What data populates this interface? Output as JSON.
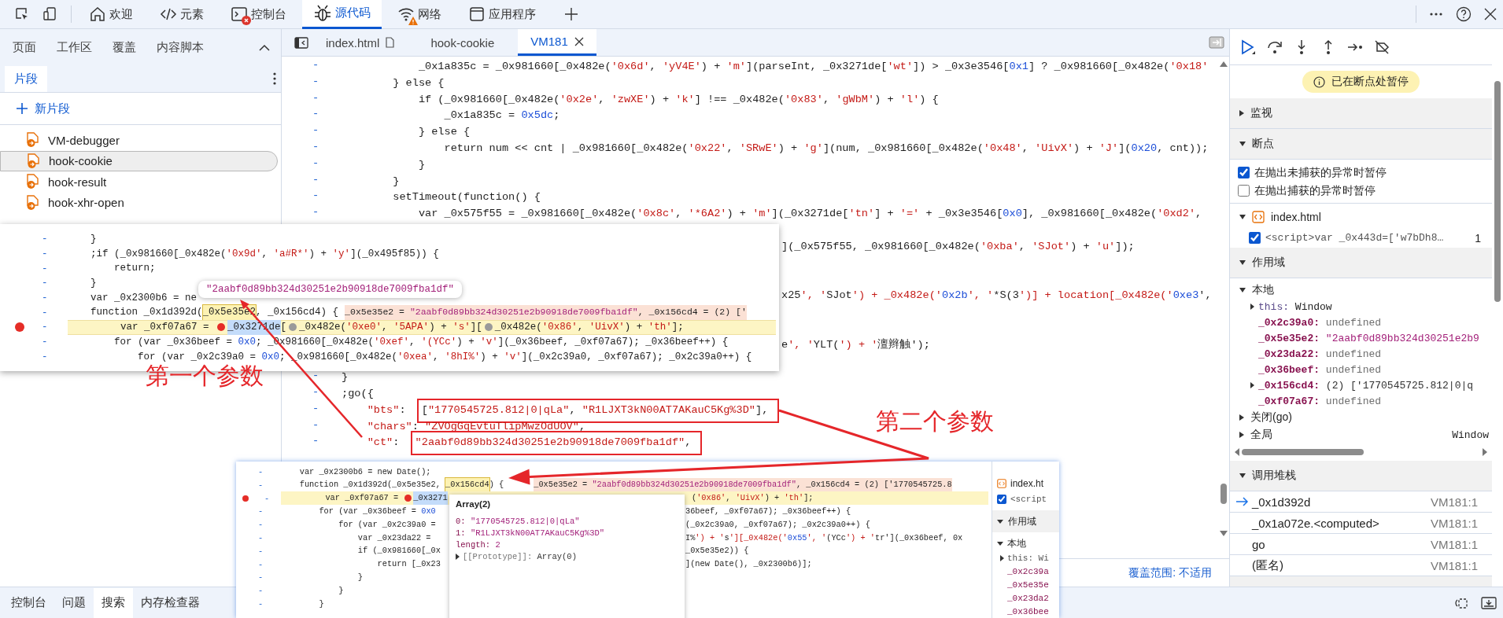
{
  "devtools_tabs": [
    {
      "label": "欢迎",
      "selected": false,
      "errors": false,
      "warnings": false
    },
    {
      "label": "元素",
      "selected": false,
      "errors": false,
      "warnings": false
    },
    {
      "label": "控制台",
      "selected": false,
      "errors": true,
      "warnings": false
    },
    {
      "label": "源代码",
      "selected": true,
      "errors": false,
      "warnings": false
    },
    {
      "label": "网络",
      "selected": false,
      "errors": false,
      "warnings": true
    },
    {
      "label": "应用程序",
      "selected": false,
      "errors": false,
      "warnings": false
    }
  ],
  "sidebar": {
    "tabs": [
      {
        "label": "页面",
        "selected": false
      },
      {
        "label": "工作区",
        "selected": false
      },
      {
        "label": "覆盖",
        "selected": false
      },
      {
        "label": "内容脚本",
        "selected": false
      }
    ],
    "subtabs": [
      {
        "label": "片段",
        "selected": true
      }
    ],
    "new_snippet": "新片段",
    "snippets": [
      {
        "name": "VM-debugger",
        "selected": false
      },
      {
        "name": "hook-cookie",
        "selected": true
      },
      {
        "name": "hook-result",
        "selected": false
      },
      {
        "name": "hook-xhr-open",
        "selected": false
      }
    ]
  },
  "editor": {
    "tabs": [
      {
        "label": "index.html",
        "selected": false,
        "kind": "file"
      },
      {
        "label": "hook-cookie",
        "selected": false,
        "kind": "snippet"
      },
      {
        "label": "VM181",
        "selected": true,
        "kind": "script"
      }
    ],
    "lines": [
      {
        "kind": "code",
        "gutter": "-",
        "text": "            _0x1a835c = _0x981660[_0x482e('0x6d', 'yV4E') + 'm'](parseInt, _0x3271de['wt']) > _0x3e3546[0x1] ? _0x981660[_0x482e('0x18'"
      },
      {
        "kind": "code",
        "gutter": "-",
        "text": "        } else {"
      },
      {
        "kind": "code",
        "gutter": "-",
        "text": "            if (_0x981660[_0x482e('0x2e', 'zwXE') + 'k'] !== _0x482e('0x83', 'gWbM') + 'l') {"
      },
      {
        "kind": "code",
        "gutter": "-",
        "text": "                _0x1a835c = 0x5dc;"
      },
      {
        "kind": "code",
        "gutter": "-",
        "text": "            } else {"
      },
      {
        "kind": "code",
        "gutter": "-",
        "text": "                return num << cnt | _0x981660[_0x482e('0x22', 'SRwE') + 'g'](num, _0x981660[_0x482e('0x48', 'UivX') + 'J'](0x20, cnt));"
      },
      {
        "kind": "code",
        "gutter": "-",
        "text": "            }"
      },
      {
        "kind": "code",
        "gutter": "-",
        "text": "        }"
      },
      {
        "kind": "code",
        "gutter": "-",
        "text": "        setTimeout(function() {"
      },
      {
        "kind": "code",
        "gutter": "-",
        "text": "            var _0x575f55 = _0x981660[_0x482e('0x8c', '*6A2') + 'm'](_0x3271de['tn'] + '=' + _0x3e3546[0x0], _0x981660[_0x482e('0xd2',"
      },
      {
        "kind": "tail",
        "text": "](_0x575f55, _0x981660[_0x482e('0xba', 'SJot') + 'u']);"
      },
      {
        "kind": "tail",
        "text": "x25', 'SJot') + _0x482e('0x2b', '*S(3')] + location[_0x482e('0xe3',"
      },
      {
        "kind": "tail",
        "text": "e', 'YLT(') + '澶辫触');"
      },
      {
        "kind": "code",
        "gutter": "-",
        "text": "}"
      },
      {
        "kind": "code",
        "gutter": "-",
        "text": ";go({"
      },
      {
        "kind": "code",
        "gutter": "-",
        "text": "    \"bts\": ",
        "boxed": "[\"1770545725.812|0|qLa\", \"R1LJXT3kN00AT7AKauC5Kg%3D\"],"
      },
      {
        "kind": "code",
        "gutter": "-",
        "text": "    \"chars\": \"ZVOgGqEvtuTlipMwzOdUOV\","
      },
      {
        "kind": "code",
        "gutter": "-",
        "text": "    \"ct\": ",
        "boxed": "\"2aabf0d89bb324d30251e2b90918de7009fba1df\","
      }
    ],
    "status": "覆盖范围: 不适用"
  },
  "debugger": {
    "paused_notice": "已在断点处暂停",
    "watch": {
      "title": "监视",
      "expanded": false
    },
    "breakpoints": {
      "title": "断点",
      "expanded": true,
      "options": [
        {
          "label": "在抛出未捕获的异常时暂停",
          "checked": true
        },
        {
          "label": "在抛出捕获的异常时暂停",
          "checked": false
        }
      ],
      "files": [
        {
          "name": "index.html",
          "expanded": true,
          "entries": [
            {
              "code": "<script>var _0x443d=['w7bDh8…",
              "line": "1",
              "checked": true
            }
          ]
        }
      ]
    },
    "scope": {
      "title": "作用域",
      "expanded": true,
      "groups": [
        {
          "name": "本地",
          "expanded": true,
          "vars": [
            {
              "name": "this:",
              "value": "Window",
              "kind": "object",
              "expandable": true
            },
            {
              "name": "_0x2c39a0:",
              "value": "undefined",
              "kind": "undefined",
              "expandable": false
            },
            {
              "name": "_0x5e35e2:",
              "value": "\"2aabf0d89bb324d30251e2b9",
              "kind": "string",
              "expandable": false
            },
            {
              "name": "_0x23da22:",
              "value": "undefined",
              "kind": "undefined",
              "expandable": false
            },
            {
              "name": "_0x36beef:",
              "value": "undefined",
              "kind": "undefined",
              "expandable": false
            },
            {
              "name": "_0x156cd4:",
              "value": "(2) ['1770545725.812|0|q",
              "kind": "array",
              "expandable": true
            },
            {
              "name": "_0xf07a67:",
              "value": "undefined",
              "kind": "undefined",
              "expandable": false
            }
          ]
        },
        {
          "name": "关闭(go)",
          "expanded": false
        },
        {
          "name": "全局",
          "expanded": false,
          "value": "Window"
        }
      ]
    },
    "call_stack": {
      "title": "调用堆栈",
      "expanded": true,
      "frames": [
        {
          "name": "_0x1d392d",
          "location": "VM181:1",
          "current": true
        },
        {
          "name": "_0x1a072e.<computed>",
          "location": "VM181:1",
          "current": false
        },
        {
          "name": "go",
          "location": "VM181:1",
          "current": false
        },
        {
          "name": "(匿名)",
          "location": "VM181:1",
          "current": false
        }
      ]
    }
  },
  "drawer": {
    "tabs": [
      {
        "label": "控制台",
        "selected": false
      },
      {
        "label": "问题",
        "selected": false
      },
      {
        "label": "搜索",
        "selected": true
      },
      {
        "label": "内存检查器",
        "selected": false
      }
    ]
  },
  "inset_1": {
    "lines": [
      {
        "gutter": "-",
        "current": false,
        "text": "    }"
      },
      {
        "gutter": "-",
        "current": false,
        "text": "    ;if (_0x981660[_0x482e('0x9d', 'a#R*') + 'y'](_0x495f85)) {"
      },
      {
        "gutter": "-",
        "current": false,
        "text": "        return;"
      },
      {
        "gutter": "-",
        "current": false,
        "text": "    }"
      },
      {
        "gutter": "-",
        "current": false,
        "text": "    var _0x2300b6 = ne"
      },
      {
        "gutter": "-",
        "current": false,
        "segments": [
          {
            "kind": "code",
            "text": "    function _0x1d392d("
          },
          {
            "kind": "hover",
            "text": "_0x5e35e2"
          },
          {
            "kind": "code",
            "text": ", _0x156cd4) {"
          },
          {
            "kind": "value",
            "text": "_0x5e35e2 = \"2aabf0d89bb324d30251e2b90918de7009fba1df\", _0x156cd4 = (2) ['"
          }
        ]
      },
      {
        "gutter": "-",
        "current": true,
        "segments": [
          {
            "kind": "code",
            "text": "        var _0xf07a67 = "
          },
          {
            "kind": "stop",
            "active": true
          },
          {
            "kind": "sel",
            "text": "_0x3271de"
          },
          {
            "kind": "code",
            "text": "["
          },
          {
            "kind": "stop",
            "active": false
          },
          {
            "kind": "code",
            "text": "_0x482e('0xe0', '5APA') + 's']["
          },
          {
            "kind": "stop",
            "active": false
          },
          {
            "kind": "code",
            "text": "_0x482e('0x86', 'UivX') + 'th'];"
          }
        ]
      },
      {
        "gutter": "-",
        "current": false,
        "text": "        for (var _0x36beef = 0x0; _0x981660[_0x482e('0xef', '(YCc') + 'v'](_0x36beef, _0xf07a67); _0x36beef++) {"
      },
      {
        "gutter": "-",
        "current": false,
        "text": "            for (var _0x2c39a0 = 0x0; _0x981660[_0x482e('0xea', '8hI%') + 'v'](_0x2c39a0, _0xf07a67); _0x2c39a0++) {"
      }
    ],
    "tooltip": "\"2aabf0d89bb324d30251e2b90918de7009fba1df\""
  },
  "inset_2": {
    "lines": [
      {
        "gutter": "-",
        "current": false,
        "text": "    var _0x2300b6 = new Date();"
      },
      {
        "gutter": "-",
        "current": false,
        "segments": [
          {
            "kind": "code",
            "text": "    function _0x1d392d(_0x5e35e2, "
          },
          {
            "kind": "hover",
            "text": "_0x156cd4"
          },
          {
            "kind": "code",
            "text": ") {"
          },
          {
            "kind": "value",
            "text": "_0x5e35e2 = \"2aabf0d89bb324d30251e2b90918de7009fba1df\", _0x156cd4 = (2) ['1770545725.8"
          }
        ]
      },
      {
        "gutter": "-",
        "current": true,
        "segments": [
          {
            "kind": "code",
            "text": "        var _0xf07a67 = "
          },
          {
            "kind": "stop",
            "active": true
          },
          {
            "kind": "sel",
            "text": "_0x3271"
          }
        ],
        "after": "('0x86', 'UivX') + 'th'];"
      },
      {
        "gutter": "-",
        "current": false,
        "text": "        for (var _0x36beef = 0x0",
        "after": "36beef, _0xf07a67); _0x36beef++) {"
      },
      {
        "gutter": "-",
        "current": false,
        "text": "            for (var _0x2c39a0 = ",
        "after": "(_0x2c39a0, _0xf07a67); _0x2c39a0++) {"
      },
      {
        "gutter": "-",
        "current": false,
        "text": "                var _0x23da22 = ",
        "after": "I%') + 's'][_0x482e('0x55', '(YCc') + 'tr'](_0x36beef, 0x"
      },
      {
        "gutter": "-",
        "current": false,
        "text": "                if (_0x981660[_0x",
        "after": "_0x5e35e2)) {"
      },
      {
        "gutter": "-",
        "current": false,
        "text": "                    return [_0x23",
        "after": "](new Date(), _0x2300b6)];"
      },
      {
        "gutter": "-",
        "current": false,
        "text": "                }"
      },
      {
        "gutter": "-",
        "current": false,
        "text": "            }"
      },
      {
        "gutter": "-",
        "current": false,
        "text": "        }"
      }
    ],
    "popup": {
      "title": "Array(2)",
      "entries": [
        {
          "key": "0:",
          "value": "\"1770545725.812|0|qLa\"",
          "expandable": false
        },
        {
          "key": "1:",
          "value": "\"R1LJXT3kN00AT7AKauC5Kg%3D\"",
          "expandable": false
        },
        {
          "key": "length:",
          "value": "2",
          "expandable": false
        },
        {
          "key": "[[Prototype]]:",
          "value": "Array(0)",
          "expandable": true
        }
      ]
    },
    "side": {
      "file": "index.ht",
      "script": "<script",
      "script_checked": true,
      "scope_title": "作用域",
      "local": "本地",
      "vars": [
        {
          "text": "this: Wi",
          "expandable": true
        },
        {
          "text": "_0x2c39a",
          "expandable": false
        },
        {
          "text": "_0x5e35e",
          "expandable": false
        },
        {
          "text": "_0x23da2",
          "expandable": false
        },
        {
          "text": "_0x36bee",
          "expandable": false
        }
      ]
    }
  },
  "annotations": {
    "labels": [
      "第一个参数",
      "第二个参数"
    ]
  }
}
